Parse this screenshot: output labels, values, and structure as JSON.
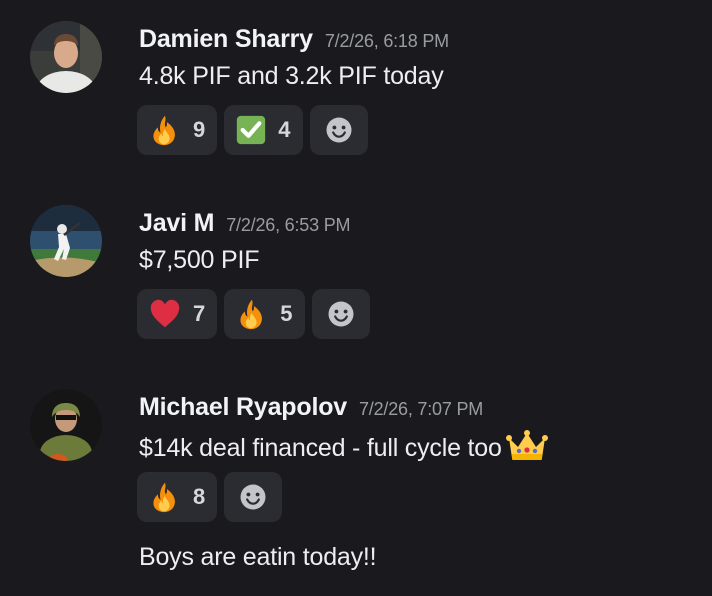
{
  "messages": [
    {
      "author": "Damien Sharry",
      "timestamp": "7/2/26, 6:18 PM",
      "text": "4.8k PIF and  3.2k PIF today",
      "reactions": [
        {
          "emoji": "fire",
          "count": "9"
        },
        {
          "emoji": "white-check-mark",
          "count": "4"
        }
      ]
    },
    {
      "author": "Javi M",
      "timestamp": "7/2/26, 6:53 PM",
      "text": "$7,500 PIF",
      "reactions": [
        {
          "emoji": "red-heart",
          "count": "7"
        },
        {
          "emoji": "fire",
          "count": "5"
        }
      ]
    },
    {
      "author": "Michael Ryapolov",
      "timestamp": "7/2/26, 7:07 PM",
      "text": "$14k deal financed - full cycle too",
      "text_emoji": "crown",
      "reactions": [
        {
          "emoji": "fire",
          "count": "8"
        }
      ],
      "followup": "Boys are eatin today!!"
    }
  ],
  "add_reaction_icon": "smiley-add-reaction-icon",
  "colors": {
    "background": "#1a1a1e",
    "reaction_bg": "#2b2c31",
    "timestamp": "#9a9ca3",
    "text": "#eeeef0"
  }
}
